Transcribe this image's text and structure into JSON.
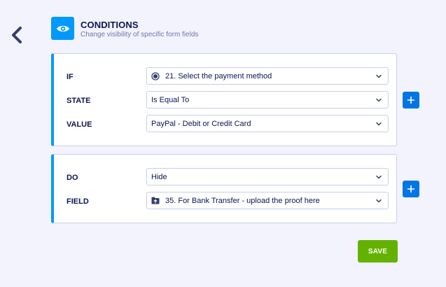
{
  "header": {
    "title": "CONDITIONS",
    "subtitle": "Change visibility of specific form fields"
  },
  "if_block": {
    "rows": [
      {
        "label": "IF",
        "value": "21. Select the payment method",
        "icon": "radio-icon"
      },
      {
        "label": "STATE",
        "value": "Is Equal To"
      },
      {
        "label": "VALUE",
        "value": "PayPal - Debit or Credit Card"
      }
    ]
  },
  "do_block": {
    "rows": [
      {
        "label": "DO",
        "value": "Hide"
      },
      {
        "label": "FIELD",
        "value": "35. For Bank Transfer - upload the proof here",
        "icon": "file-upload-icon"
      }
    ]
  },
  "actions": {
    "save_label": "SAVE"
  },
  "colors": {
    "accent": "#0099ff",
    "add_button": "#0075e3",
    "save_button": "#64b200",
    "background": "#f3f3fe",
    "text": "#0a1551"
  }
}
